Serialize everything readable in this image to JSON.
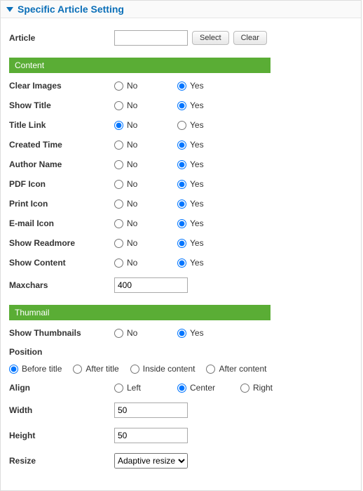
{
  "panel": {
    "title": "Specific Article Setting"
  },
  "article": {
    "label": "Article",
    "value": "",
    "select_btn": "Select",
    "clear_btn": "Clear"
  },
  "sections": {
    "content": "Content",
    "thumbnail": "Thumnail"
  },
  "labels": {
    "no": "No",
    "yes": "Yes",
    "clear_images": "Clear Images",
    "show_title": "Show Title",
    "title_link": "Title Link",
    "created_time": "Created Time",
    "author_name": "Author Name",
    "pdf_icon": "PDF Icon",
    "print_icon": "Print Icon",
    "email_icon": "E-mail Icon",
    "show_readmore": "Show Readmore",
    "show_content": "Show Content",
    "maxchars": "Maxchars",
    "show_thumbnails": "Show Thumbnails",
    "position": "Position",
    "position_opts": {
      "before": "Before title",
      "after": "After title",
      "inside": "Inside content",
      "aftercontent": "After content"
    },
    "align": "Align",
    "align_opts": {
      "left": "Left",
      "center": "Center",
      "right": "Right"
    },
    "width": "Width",
    "height": "Height",
    "resize": "Resize",
    "resize_selected": "Adaptive resize"
  },
  "values": {
    "clear_images": "yes",
    "show_title": "yes",
    "title_link": "no",
    "created_time": "yes",
    "author_name": "yes",
    "pdf_icon": "yes",
    "print_icon": "yes",
    "email_icon": "yes",
    "show_readmore": "yes",
    "show_content": "yes",
    "maxchars": "400",
    "show_thumbnails": "yes",
    "position": "before",
    "align": "center",
    "width": "50",
    "height": "50",
    "resize": "Adaptive resize"
  }
}
